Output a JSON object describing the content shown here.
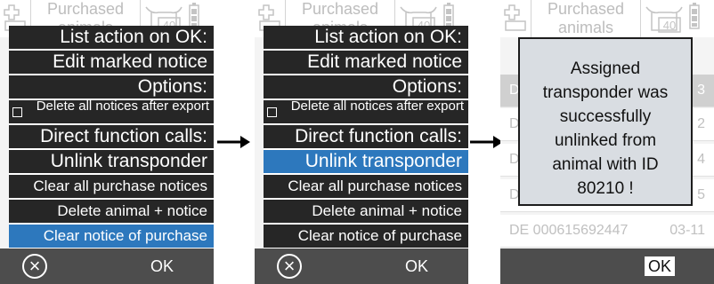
{
  "header": {
    "title": "Purchased animals",
    "stable_count": "40"
  },
  "menu": {
    "items": [
      "List action on OK:",
      "Edit marked notice",
      "Options:",
      "Delete all notices after export",
      "Direct function calls:",
      "Unlink transponder",
      "Clear all purchase notices",
      "Delete animal + notice",
      "Clear notice of purchase"
    ]
  },
  "footer": {
    "ok_label": "OK",
    "cancel_icon": "cancel-circle-icon"
  },
  "background_rows": {
    "row1": {
      "id": "D",
      "date": "3"
    },
    "row2": {
      "id": "D",
      "date": "2"
    },
    "row3": {
      "id": "D",
      "date": "4"
    },
    "row4": {
      "id": "D",
      "date": "5"
    },
    "row5": {
      "id": "DE 000615692447",
      "date": "03-11"
    }
  },
  "dialog": {
    "message": "Assigned\ntransponder was\nsuccessfully\nunlinked from\nanimal with ID\n80210 !"
  },
  "colors": {
    "menu_item_bg": "#262626",
    "selected_bg": "#2d78bd",
    "footer_bg": "#4d4d4d",
    "dialog_bg": "#d9dde2"
  }
}
